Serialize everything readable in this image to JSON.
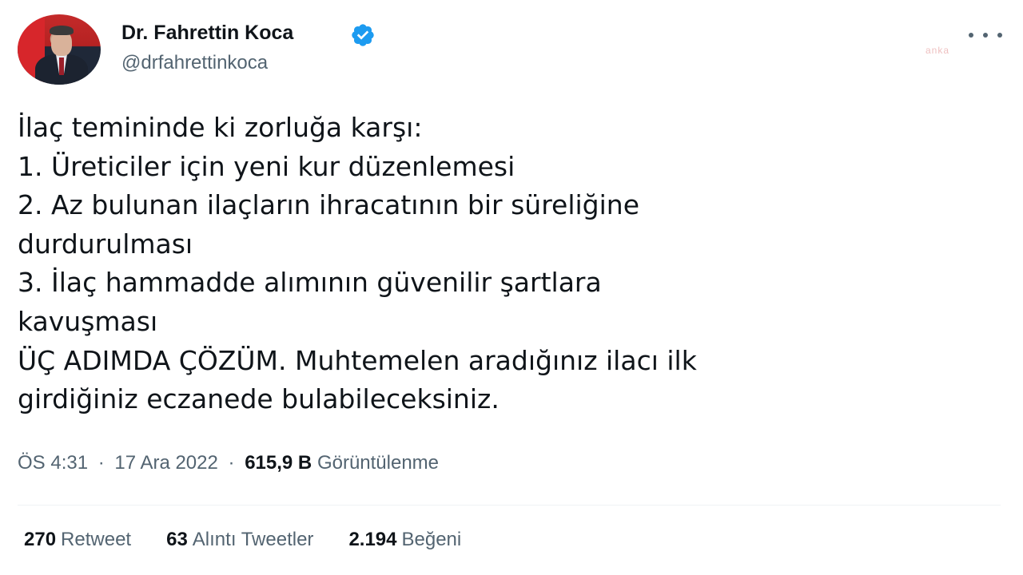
{
  "author": {
    "display_name": "Dr. Fahrettin Koca",
    "handle": "@drfahrettinkoca",
    "verified": true,
    "avatar_icon": "profile-photo"
  },
  "watermark": "anka",
  "tweet": {
    "lines": [
      "İlaç temininde ki zorluğa karşı:",
      "1. Üreticiler için yeni kur düzenlemesi",
      "2. Az bulunan ilaçların ihracatının bir süreliğine",
      "durdurulması",
      "3. İlaç hammadde alımının güvenilir şartlara",
      "kavuşması",
      "ÜÇ ADIMDA ÇÖZÜM. Muhtemelen aradığınız ilacı ilk",
      "girdiğiniz eczanede bulabileceksiniz."
    ]
  },
  "meta": {
    "time": "ÖS 4:31",
    "date": "17 Ara 2022",
    "views_count": "615,9 B",
    "views_label": "Görüntülenme",
    "separator": "·"
  },
  "stats": {
    "retweets_count": "270",
    "retweets_label": "Retweet",
    "quotes_count": "63",
    "quotes_label": "Alıntı Tweetler",
    "likes_count": "2.194",
    "likes_label": "Beğeni"
  },
  "colors": {
    "text_primary": "#0f1419",
    "text_secondary": "#536471",
    "verified_blue": "#1d9bf0",
    "divider": "#eff3f4"
  }
}
